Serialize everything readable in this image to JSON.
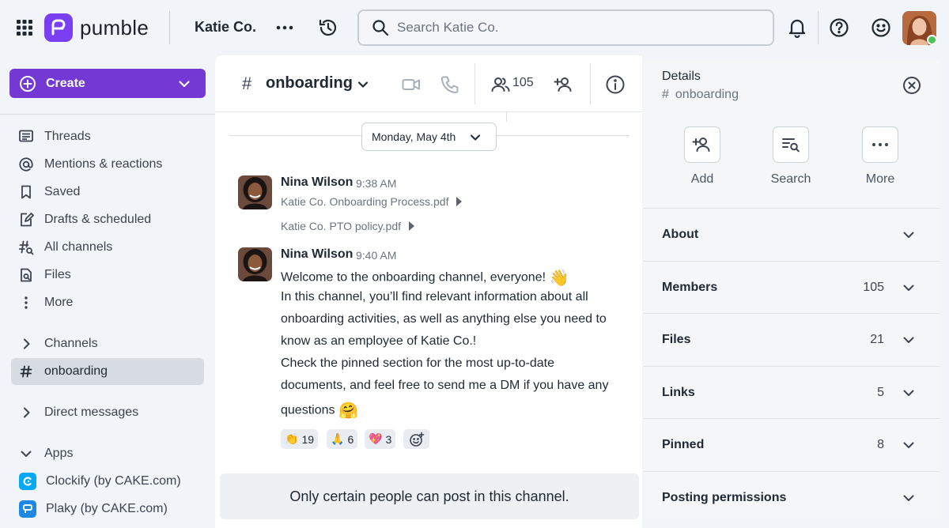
{
  "brand": {
    "name": "pumble",
    "accent": "#7438d4"
  },
  "topbar": {
    "workspace": "Katie Co.",
    "search_placeholder": "Search Katie Co.",
    "icons": [
      "apps-grid-icon",
      "more-horizontal-icon",
      "history-icon",
      "search-icon",
      "bell-icon",
      "help-icon",
      "emoji-icon"
    ]
  },
  "sidebar": {
    "create_label": "Create",
    "nav": [
      {
        "label": "Threads",
        "icon": "threads-icon"
      },
      {
        "label": "Mentions & reactions",
        "icon": "at-icon"
      },
      {
        "label": "Saved",
        "icon": "bookmark-icon"
      },
      {
        "label": "Drafts & scheduled",
        "icon": "draft-icon"
      },
      {
        "label": "All channels",
        "icon": "channels-search-icon"
      },
      {
        "label": "Files",
        "icon": "files-icon"
      },
      {
        "label": "More",
        "icon": "more-vertical-icon"
      }
    ],
    "channels_label": "Channels",
    "active_channel": "onboarding",
    "dm_label": "Direct messages",
    "apps_label": "Apps",
    "apps": [
      {
        "label": "Clockify (by CAKE.com)",
        "color": "#03a9f4"
      },
      {
        "label": "Plaky (by CAKE.com)",
        "color": "#1e88e5"
      }
    ]
  },
  "channel": {
    "hash": "#",
    "name": "onboarding",
    "member_count": "105",
    "date_label": "Monday, May 4th",
    "messages": [
      {
        "author": "Nina Wilson",
        "time": "9:38 AM",
        "attachments": [
          "Katie Co. Onboarding Process.pdf",
          "Katie Co. PTO policy.pdf"
        ]
      },
      {
        "author": "Nina Wilson",
        "time": "9:40 AM",
        "lines": [
          "Welcome to the onboarding channel, everyone!",
          "In this channel, you’ll find relevant information about all",
          "onboarding activities, as well as anything else you need to",
          "know as an employee of Katie Co.!",
          "Check the pinned section for the most up-to-date",
          "documents, and feel free to send me a DM if you have any",
          "questions"
        ],
        "emoji_wave": "👋",
        "emoji_hug": "🤗",
        "reactions": [
          {
            "emoji": "👏",
            "count": "19"
          },
          {
            "emoji": "🙏",
            "count": "6"
          },
          {
            "emoji": "💖",
            "count": "3"
          }
        ]
      }
    ],
    "notice": "Only certain people can post in this channel."
  },
  "details": {
    "title": "Details",
    "channel": "onboarding",
    "actions": [
      {
        "label": "Add",
        "icon": "add-person-icon"
      },
      {
        "label": "Search",
        "icon": "search-list-icon"
      },
      {
        "label": "More",
        "icon": "more-horizontal-icon"
      }
    ],
    "sections": [
      {
        "label": "About",
        "count": ""
      },
      {
        "label": "Members",
        "count": "105"
      },
      {
        "label": "Files",
        "count": "21"
      },
      {
        "label": "Links",
        "count": "5"
      },
      {
        "label": "Pinned",
        "count": "8"
      },
      {
        "label": "Posting permissions",
        "count": ""
      }
    ]
  }
}
